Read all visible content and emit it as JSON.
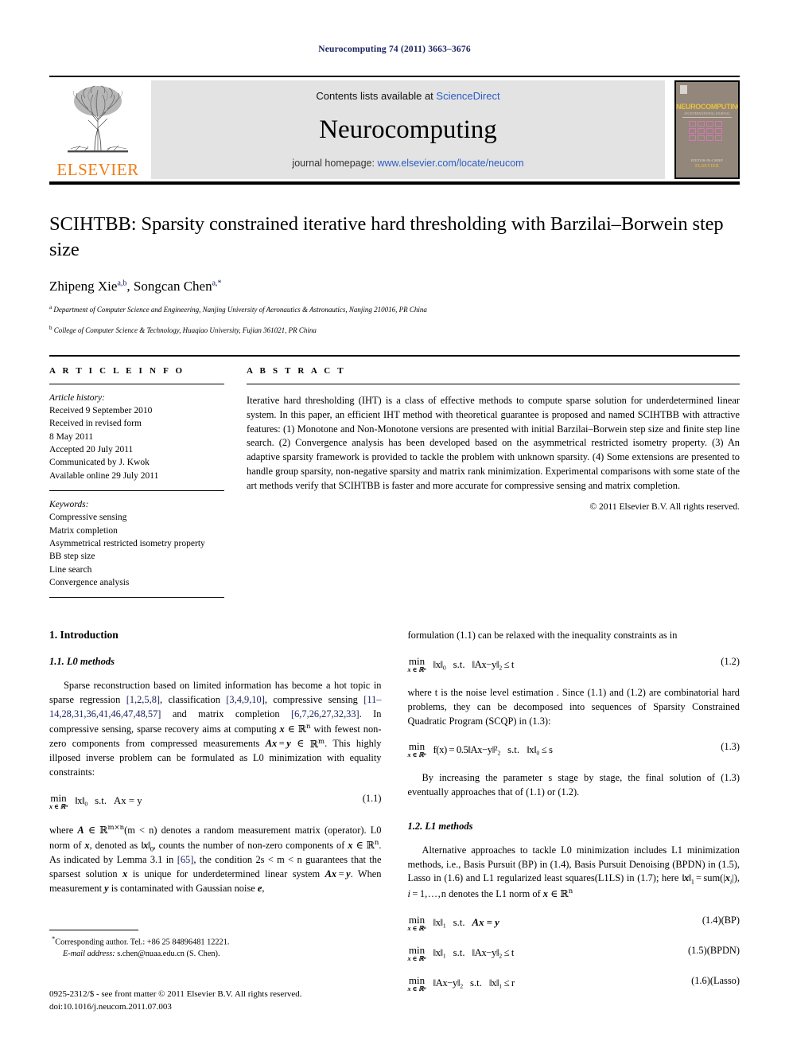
{
  "running_head": "Neurocomputing 74 (2011) 3663–3676",
  "header": {
    "contents_prefix": "Contents lists available at ",
    "sciencedirect": "ScienceDirect",
    "journal_name": "Neurocomputing",
    "homepage_prefix": "journal homepage: ",
    "homepage_url": "www.elsevier.com/locate/neucom",
    "publisher_wordmark": "ELSEVIER",
    "cover": {
      "title": "NEUROCOMPUTING",
      "subtitle": "AN INTERNATIONAL JOURNAL",
      "foot_line1": "EDITOR-IN-CHIEF",
      "foot_line2": "ELSEVIER"
    },
    "colors": {
      "link": "#2b5cc4",
      "elsevier_orange": "#f07d19",
      "band_gray": "#e3e3e3",
      "cover_bg": "#93867a",
      "cover_gold": "#e8c23c"
    }
  },
  "article": {
    "title": "SCIHTBB: Sparsity constrained iterative hard thresholding with Barzilai–Borwein step size",
    "authors": "Zhipeng Xie, Songcan Chen",
    "author1_name": "Zhipeng Xie",
    "author1_sup": "a,b",
    "author2_name": "Songcan Chen",
    "author2_sup": "a,",
    "author2_star": "*",
    "affiliations": [
      {
        "marker": "a",
        "text": "Department of Computer Science and Engineering, Nanjing University of Aeronautics & Astronautics, Nanjing 210016, PR China"
      },
      {
        "marker": "b",
        "text": "College of Computer Science & Technology, Huaqiao University, Fujian 361021, PR China"
      }
    ]
  },
  "article_info": {
    "heading": "A R T I C L E   I N F O",
    "history_label": "Article history:",
    "history": [
      "Received 9 September 2010",
      "Received in revised form",
      "8 May 2011",
      "Accepted 20 July 2011",
      "Communicated by J. Kwok",
      "Available online 29 July 2011"
    ],
    "keywords_label": "Keywords:",
    "keywords": [
      "Compressive sensing",
      "Matrix completion",
      "Asymmetrical restricted isometry property",
      "BB step size",
      "Line search",
      "Convergence analysis"
    ]
  },
  "abstract": {
    "heading": "A B S T R A C T",
    "text": "Iterative hard thresholding (IHT) is a class of effective methods to compute sparse solution for underdetermined linear system. In this paper, an efficient IHT method with theoretical guarantee is proposed and named SCIHTBB with attractive features: (1) Monotone and Non-Monotone versions are presented with initial Barzilai–Borwein step size and finite step line search. (2) Convergence analysis has been developed based on the asymmetrical restricted isometry property. (3) An adaptive sparsity framework is provided to tackle the problem with unknown sparsity. (4) Some extensions are presented to handle group sparsity, non-negative sparsity and matrix rank minimization. Experimental comparisons with some state of the art methods verify that SCIHTBB is faster and more accurate for compressive sensing and matrix completion.",
    "copyright": "© 2011 Elsevier B.V. All rights reserved."
  },
  "body": {
    "section1_heading": "1.  Introduction",
    "section11_heading": "1.1.  L0 methods",
    "p1_a": "Sparse reconstruction based on limited information has become a hot topic in sparse regression ",
    "p1_ref1": "[1,2,5,8]",
    "p1_b": ", classification ",
    "p1_ref2": "[3,4,9,10]",
    "p1_c": ", compressive sensing ",
    "p1_ref3": "[11–14,28,31,36,41,46,47,48,57]",
    "p1_d": " and matrix completion ",
    "p1_ref4": "[6,7,26,27,32,33]",
    "p1_e": ". In compressive sensing, sparse recovery aims at computing ",
    "p1_f": " with fewest non-zero components from compressed measurements ",
    "p1_g": ". This highly illposed inverse problem can be formulated as L0 minimization with equality constraints:",
    "eq11_num": "(1.1)",
    "eq11_min": "min",
    "eq11_sub": "x ∈ ℝⁿ",
    "eq11_obj": "‖x‖₀",
    "eq11_st": "s.t.",
    "eq11_cons": "Ax = y",
    "p2_a": "where ",
    "p2_b": "(m < n) denotes a random measurement matrix (operator). L0 norm of ",
    "p2_c": ", denoted as ",
    "p2_d": ", counts the number of non-zero components of ",
    "p2_e": ". As indicated by Lemma 3.1 in ",
    "p2_ref": "[65]",
    "p2_f": ", the condition 2s < m < n guarantees that the sparsest solution ",
    "p2_g": " is unique for underdetermined linear system ",
    "p2_h": ". When measurement ",
    "p2_i": " is contaminated with Gaussian noise ",
    "p2_j": ",",
    "p3": "formulation (1.1) can be relaxed with the inequality constraints as in",
    "eq12_num": "(1.2)",
    "eq12_obj": "‖x‖₀",
    "eq12_st": "s.t.",
    "eq12_cons": "‖Ax−y‖₂ ≤ t",
    "p4": "where t is the noise level estimation . Since (1.1) and (1.2) are combinatorial hard problems, they can be decomposed into sequences of Sparsity Constrained Quadratic Program (SCQP) in (1.3):",
    "eq13_num": "(1.3)",
    "eq13_obj": "f(x) = 0.5‖Ax−y‖²₂",
    "eq13_st": "s.t.",
    "eq13_cons": "‖x‖₀ ≤ s",
    "p5": "By increasing the parameter s stage by stage, the final solution of (1.3) eventually approaches that of (1.1) or (1.2).",
    "section12_heading": "1.2.  L1 methods",
    "p6_a": "Alternative approaches to tackle L0 minimization includes L1 minimization methods, i.e., Basis Pursuit (BP) in (1.4), Basis Pursuit Denoising (BPDN) in (1.5), Lasso in (1.6) and L1 regularized least squares(L1LS) in (1.7); here ",
    "p6_b": " denotes the L1 norm of ",
    "eq14_num": "(1.4)(BP)",
    "eq14_obj": "‖x‖₁",
    "eq14_st": "s.t.",
    "eq14_cons": "Ax = y",
    "eq15_num": "(1.5)(BPDN)",
    "eq15_obj": "‖x‖₁",
    "eq15_st": "s.t.",
    "eq15_cons": "‖Ax−y‖₂ ≤ t",
    "eq16_num": "(1.6)(Lasso)",
    "eq16_obj": "‖Ax−y‖₂",
    "eq16_st": "s.t.",
    "eq16_cons": "‖x‖₁ ≤ r"
  },
  "footnote": {
    "marker": "*",
    "line1": "Corresponding author. Tel.: +86 25 84896481 12221.",
    "email_label": "E-mail address:",
    "email": "s.chen@nuaa.edu.cn (S. Chen)."
  },
  "footer": {
    "line1": "0925-2312/$ - see front matter © 2011 Elsevier B.V. All rights reserved.",
    "line2": "doi:10.1016/j.neucom.2011.07.003"
  }
}
